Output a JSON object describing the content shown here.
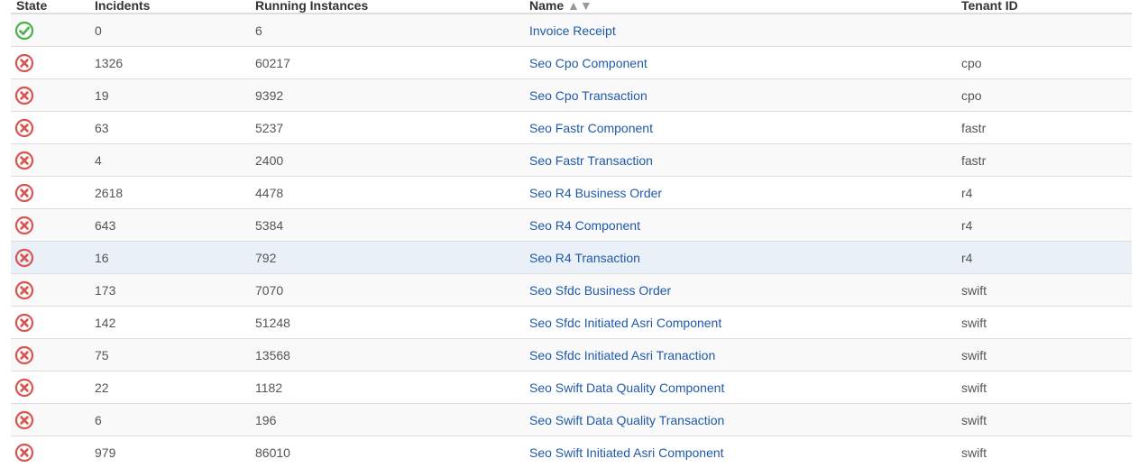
{
  "colors": {
    "ok": "#4cae4c",
    "error": "#d9534f",
    "link": "#1f5aa8",
    "row_alt": "#f9f9f9",
    "row_hover": "#e9f0f7",
    "border": "#dddddd"
  },
  "table": {
    "headers": {
      "state": "State",
      "incidents": "Incidents",
      "running": "Running Instances",
      "name": "Name",
      "name_sort": "▲▼",
      "tenant": "Tenant ID"
    },
    "rows": [
      {
        "state": "check-circle-icon",
        "incidents": "0",
        "running": "6",
        "name": "Invoice Receipt",
        "tenant": ""
      },
      {
        "state": "x-circle-icon",
        "incidents": "1326",
        "running": "60217",
        "name": "Seo Cpo Component",
        "tenant": "cpo"
      },
      {
        "state": "x-circle-icon",
        "incidents": "19",
        "running": "9392",
        "name": "Seo Cpo Transaction",
        "tenant": "cpo"
      },
      {
        "state": "x-circle-icon",
        "incidents": "63",
        "running": "5237",
        "name": "Seo Fastr Component",
        "tenant": "fastr"
      },
      {
        "state": "x-circle-icon",
        "incidents": "4",
        "running": "2400",
        "name": "Seo Fastr Transaction",
        "tenant": "fastr"
      },
      {
        "state": "x-circle-icon",
        "incidents": "2618",
        "running": "4478",
        "name": "Seo R4 Business Order",
        "tenant": "r4"
      },
      {
        "state": "x-circle-icon",
        "incidents": "643",
        "running": "5384",
        "name": "Seo R4 Component",
        "tenant": "r4"
      },
      {
        "state": "x-circle-icon",
        "incidents": "16",
        "running": "792",
        "name": "Seo R4 Transaction",
        "tenant": "r4"
      },
      {
        "state": "x-circle-icon",
        "incidents": "173",
        "running": "7070",
        "name": "Seo Sfdc Business Order",
        "tenant": "swift"
      },
      {
        "state": "x-circle-icon",
        "incidents": "142",
        "running": "51248",
        "name": "Seo Sfdc Initiated Asri Component",
        "tenant": "swift"
      },
      {
        "state": "x-circle-icon",
        "incidents": "75",
        "running": "13568",
        "name": "Seo Sfdc Initiated Asri Tranaction",
        "tenant": "swift"
      },
      {
        "state": "x-circle-icon",
        "incidents": "22",
        "running": "1182",
        "name": "Seo Swift Data Quality Component",
        "tenant": "swift"
      },
      {
        "state": "x-circle-icon",
        "incidents": "6",
        "running": "196",
        "name": "Seo Swift Data Quality Transaction",
        "tenant": "swift"
      },
      {
        "state": "x-circle-icon",
        "incidents": "979",
        "running": "86010",
        "name": "Seo Swift Initiated Asri Component",
        "tenant": "swift"
      }
    ]
  }
}
